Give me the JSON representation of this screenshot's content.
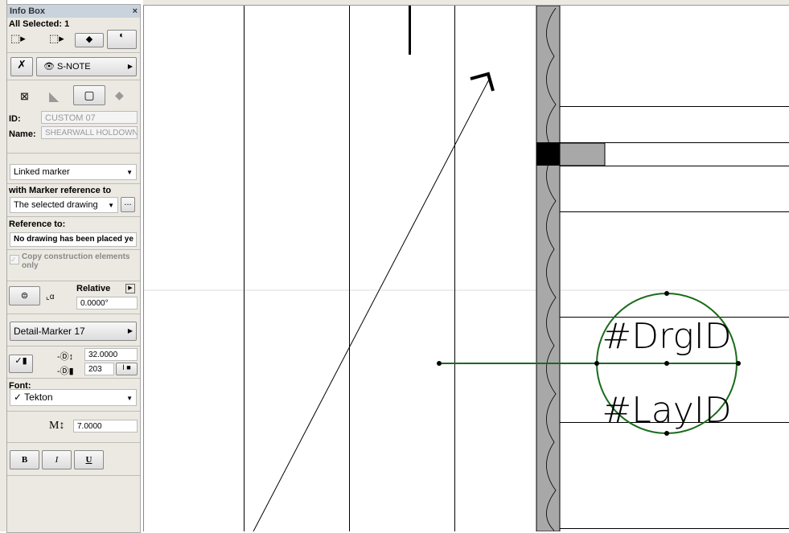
{
  "panel": {
    "title": "Info Box",
    "close": "×",
    "all_selected": "All Selected: 1",
    "layer": "S-NOTE",
    "id_label": "ID:",
    "id_value": "CUSTOM 07",
    "name_label": "Name:",
    "name_value": "SHEARWALL HOLDOWN",
    "marker_type": "Linked marker",
    "marker_ref_label": "with Marker reference to",
    "marker_ref_value": "The selected drawing",
    "more_button": "...",
    "reference_label": "Reference to:",
    "reference_value": "No drawing has been placed ye",
    "copy_label": "Copy construction elements only",
    "relative_label": "Relative",
    "angle": "0.0000°",
    "marker_name": "Detail-Marker 17",
    "size_value": "32.0000",
    "pen_value": "203",
    "font_label": "Font:",
    "font_value": "✓ Tekton",
    "text_size_label": "M↕",
    "text_size": "7.0000",
    "bold": "B",
    "italic": "I",
    "underline": "U"
  },
  "drawing": {
    "drawing_id": "#DrgID",
    "layout_id": "#LayID",
    "marker_color": "#1a6b1a",
    "wall_fill": "#a8a8a8"
  }
}
